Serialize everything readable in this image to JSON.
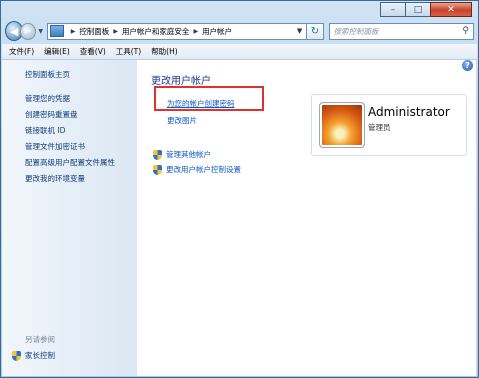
{
  "window": {
    "buttons": {
      "minimize": "–",
      "maximize": "□",
      "close": "✕"
    }
  },
  "navbar": {
    "back_icon": "back-arrow-icon",
    "forward_icon": "forward-arrow-icon",
    "breadcrumbs": [
      "控制面板",
      "用户帐户和家庭安全",
      "用户帐户"
    ],
    "refresh_icon": "refresh-icon",
    "search_placeholder": "搜索控制面板"
  },
  "menubar": {
    "items": [
      "文件(F)",
      "编辑(E)",
      "查看(V)",
      "工具(T)",
      "帮助(H)"
    ]
  },
  "sidebar": {
    "home": "控制面板主页",
    "links": [
      "管理您的凭据",
      "创建密码重置盘",
      "链接联机 ID",
      "管理文件加密证书",
      "配置高级用户配置文件属性",
      "更改我的环境变量"
    ],
    "see_also": "另请参阅",
    "family": "家长控制"
  },
  "main": {
    "title": "更改用户帐户",
    "create_password": "为您的帐户创建密码",
    "change_picture": "更改图片",
    "manage_other": "管理其他帐户",
    "uac_settings": "更改用户帐户控制设置",
    "account_name": "Administrator",
    "account_role": "管理员"
  },
  "colors": {
    "link": "#0b58c7",
    "title": "#1c3b8e",
    "highlight": "#e23030"
  }
}
